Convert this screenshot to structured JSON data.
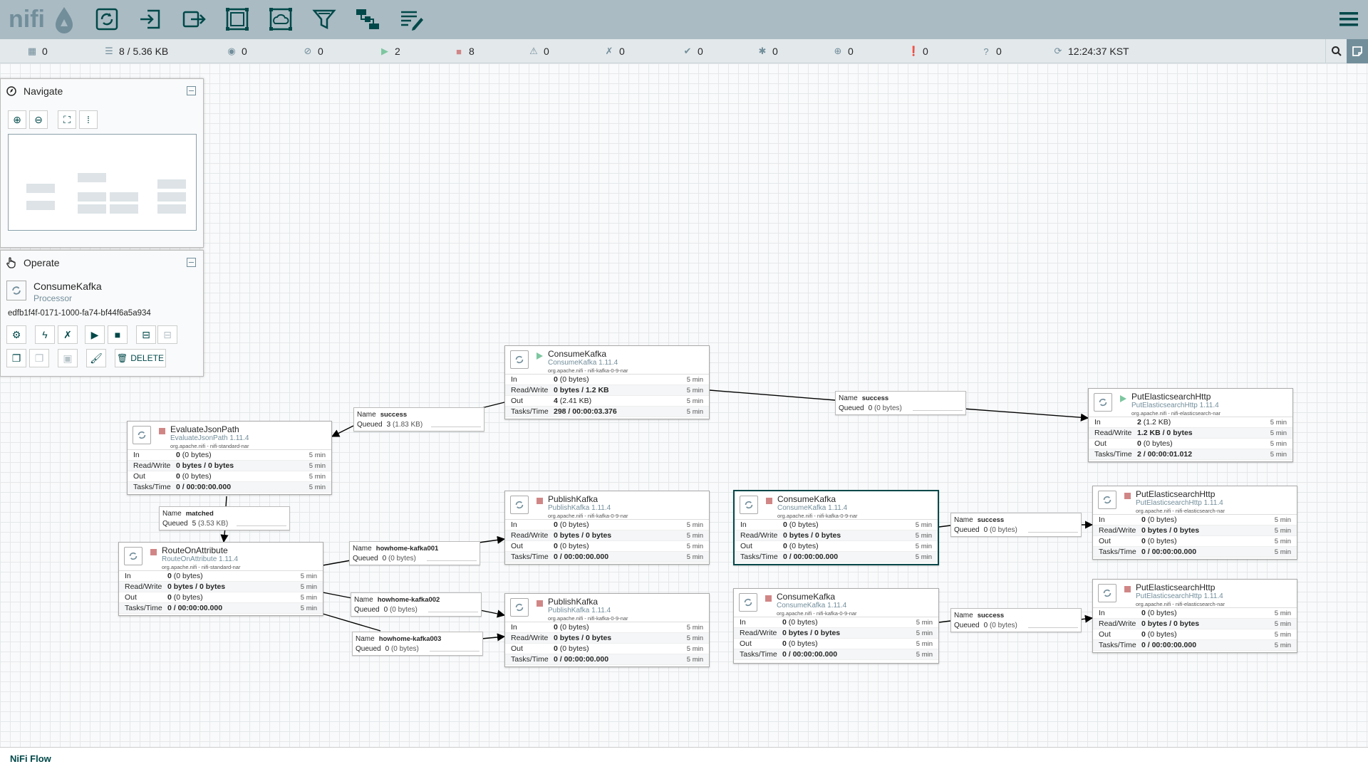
{
  "header": {
    "logo_text": "nifi",
    "toolbar": [
      {
        "name": "processor",
        "icon": "processor-icon"
      },
      {
        "name": "input-port",
        "icon": "input-port-icon"
      },
      {
        "name": "output-port",
        "icon": "output-port-icon"
      },
      {
        "name": "process-group",
        "icon": "process-group-icon"
      },
      {
        "name": "remote-process-group",
        "icon": "remote-process-group-icon"
      },
      {
        "name": "funnel",
        "icon": "funnel-icon"
      },
      {
        "name": "template",
        "icon": "template-icon"
      },
      {
        "name": "label",
        "icon": "label-icon"
      }
    ]
  },
  "status": {
    "cluster": "0",
    "queued": "8 / 5.36 KB",
    "transmitting": "0",
    "not_transmitting": "0",
    "running": "2",
    "stopped": "8",
    "invalid": "0",
    "disabled": "0",
    "up_to_date": "0",
    "locally_modified": "0",
    "stale": "0",
    "locally_modified_stale": "0",
    "sync_failure": "0",
    "refresh_time": "12:24:37 KST"
  },
  "navigate": {
    "title": "Navigate"
  },
  "operate": {
    "title": "Operate",
    "component_name": "ConsumeKafka",
    "component_type": "Processor",
    "component_id": "edfb1f4f-0171-1000-fa74-bf44f6a5a934",
    "delete_label": "DELETE"
  },
  "processors": [
    {
      "id": "p1",
      "name": "ConsumeKafka",
      "type": "ConsumeKafka 1.11.4",
      "bundle": "org.apache.nifi - nifi-kafka-0-9-nar",
      "state": "run",
      "in": "0",
      "in_b": "(0 bytes)",
      "rw": "0 bytes / 1.2 KB",
      "out": "4",
      "out_b": "(2.41 KB)",
      "tasks": "298 / 00:00:03.376"
    },
    {
      "id": "p2",
      "name": "EvaluateJsonPath",
      "type": "EvaluateJsonPath 1.11.4",
      "bundle": "org.apache.nifi - nifi-standard-nar",
      "state": "stop",
      "in": "0",
      "in_b": "(0 bytes)",
      "rw": "0 bytes / 0 bytes",
      "out": "0",
      "out_b": "(0 bytes)",
      "tasks": "0 / 00:00:00.000"
    },
    {
      "id": "p3",
      "name": "RouteOnAttribute",
      "type": "RouteOnAttribute 1.11.4",
      "bundle": "org.apache.nifi - nifi-standard-nar",
      "state": "stop",
      "in": "0",
      "in_b": "(0 bytes)",
      "rw": "0 bytes / 0 bytes",
      "out": "0",
      "out_b": "(0 bytes)",
      "tasks": "0 / 00:00:00.000"
    },
    {
      "id": "p4",
      "name": "PutElasticsearchHttp",
      "type": "PutElasticsearchHttp 1.11.4",
      "bundle": "org.apache.nifi - nifi-elasticsearch-nar",
      "state": "run",
      "in": "2",
      "in_b": "(1.2 KB)",
      "rw": "1.2 KB / 0 bytes",
      "out": "0",
      "out_b": "(0 bytes)",
      "tasks": "2 / 00:00:01.012"
    },
    {
      "id": "p5",
      "name": "PublishKafka",
      "type": "PublishKafka 1.11.4",
      "bundle": "org.apache.nifi - nifi-kafka-0-9-nar",
      "state": "stop",
      "in": "0",
      "in_b": "(0 bytes)",
      "rw": "0 bytes / 0 bytes",
      "out": "0",
      "out_b": "(0 bytes)",
      "tasks": "0 / 00:00:00.000"
    },
    {
      "id": "p6",
      "name": "ConsumeKafka",
      "type": "ConsumeKafka 1.11.4",
      "bundle": "org.apache.nifi - nifi-kafka-0-9-nar",
      "state": "stop",
      "in": "0",
      "in_b": "(0 bytes)",
      "rw": "0 bytes / 0 bytes",
      "out": "0",
      "out_b": "(0 bytes)",
      "tasks": "0 / 00:00:00.000"
    },
    {
      "id": "p7",
      "name": "PutElasticsearchHttp",
      "type": "PutElasticsearchHttp 1.11.4",
      "bundle": "org.apache.nifi - nifi-elasticsearch-nar",
      "state": "stop",
      "in": "0",
      "in_b": "(0 bytes)",
      "rw": "0 bytes / 0 bytes",
      "out": "0",
      "out_b": "(0 bytes)",
      "tasks": "0 / 00:00:00.000"
    },
    {
      "id": "p8",
      "name": "PublishKafka",
      "type": "PublishKafka 1.11.4",
      "bundle": "org.apache.nifi - nifi-kafka-0-9-nar",
      "state": "stop",
      "in": "0",
      "in_b": "(0 bytes)",
      "rw": "0 bytes / 0 bytes",
      "out": "0",
      "out_b": "(0 bytes)",
      "tasks": "0 / 00:00:00.000"
    },
    {
      "id": "p9",
      "name": "ConsumeKafka",
      "type": "ConsumeKafka 1.11.4",
      "bundle": "org.apache.nifi - nifi-kafka-0-9-nar",
      "state": "stop",
      "in": "0",
      "in_b": "(0 bytes)",
      "rw": "0 bytes / 0 bytes",
      "out": "0",
      "out_b": "(0 bytes)",
      "tasks": "0 / 00:00:00.000"
    },
    {
      "id": "p10",
      "name": "PutElasticsearchHttp",
      "type": "PutElasticsearchHttp 1.11.4",
      "bundle": "org.apache.nifi - nifi-elasticsearch-nar",
      "state": "stop",
      "in": "0",
      "in_b": "(0 bytes)",
      "rw": "0 bytes / 0 bytes",
      "out": "0",
      "out_b": "(0 bytes)",
      "tasks": "0 / 00:00:00.000"
    }
  ],
  "time_window": "5 min",
  "row_labels": {
    "in": "In",
    "rw": "Read/Write",
    "out": "Out",
    "tasks": "Tasks/Time"
  },
  "conn_labels": {
    "name": "Name",
    "queued": "Queued"
  },
  "connections": [
    {
      "id": "c1",
      "name": "success",
      "queued": "3",
      "queued_b": "(1.83 KB)"
    },
    {
      "id": "c2",
      "name": "success",
      "queued": "0",
      "queued_b": "(0 bytes)"
    },
    {
      "id": "c3",
      "name": "matched",
      "queued": "5",
      "queued_b": "(3.53 KB)"
    },
    {
      "id": "c4",
      "name": "howhome-kafka001",
      "queued": "0",
      "queued_b": "(0 bytes)"
    },
    {
      "id": "c5",
      "name": "howhome-kafka002",
      "queued": "0",
      "queued_b": "(0 bytes)"
    },
    {
      "id": "c6",
      "name": "howhome-kafka003",
      "queued": "0",
      "queued_b": "(0 bytes)"
    },
    {
      "id": "c7",
      "name": "success",
      "queued": "0",
      "queued_b": "(0 bytes)"
    },
    {
      "id": "c8",
      "name": "success",
      "queued": "0",
      "queued_b": "(0 bytes)"
    }
  ],
  "footer": {
    "breadcrumb": "NiFi Flow"
  },
  "colors": {
    "header": "#aabbc3",
    "accent": "#004849",
    "running": "#7dc7a0",
    "stopped": "#d18686",
    "muted": "#728e9b"
  }
}
